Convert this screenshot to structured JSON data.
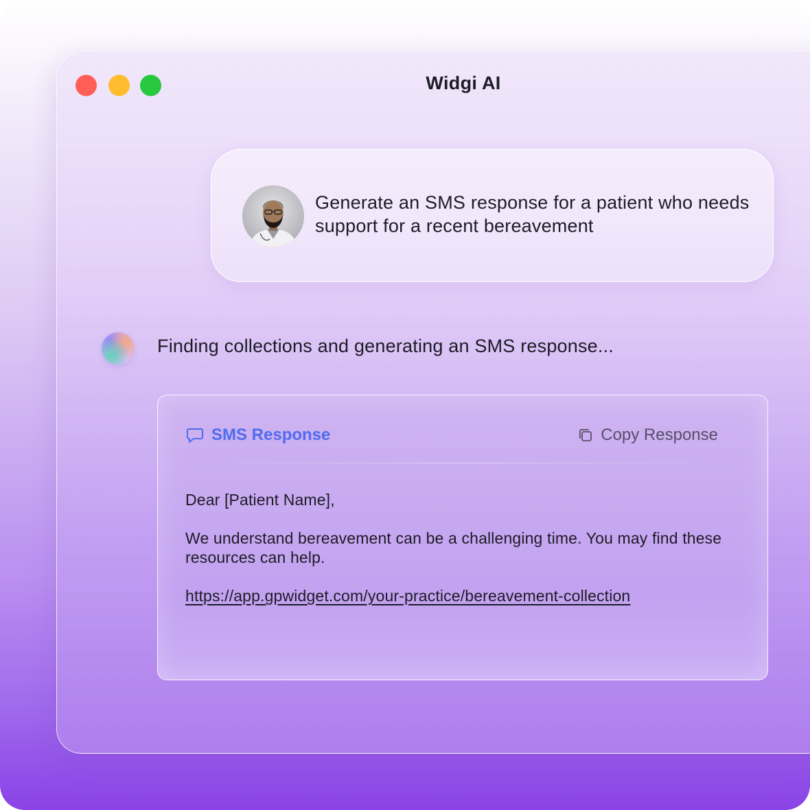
{
  "window": {
    "title": "Widgi AI",
    "controls": {
      "close_color": "#ff5f57",
      "minimize_color": "#febc2e",
      "maximize_color": "#28c840"
    }
  },
  "user_message": {
    "avatar": "user-avatar-photo",
    "text": "Generate an SMS response for a patient who needs support for a recent bereavement"
  },
  "assistant": {
    "avatar": "ai-orb-icon",
    "status_text": "Finding collections and generating an SMS response..."
  },
  "response_card": {
    "tab_label": "SMS Response",
    "tab_icon": "chat-bubble-icon",
    "copy_label": "Copy Response",
    "copy_icon": "copy-icon",
    "greeting": "Dear [Patient Name],",
    "body": "We understand bereavement can be a challenging time. You may find these resources can help.",
    "link": "https://app.gpwidget.com/your-practice/bereavement-collection"
  },
  "colors": {
    "accent": "#4f6cf0",
    "text": "#1c1c26"
  }
}
